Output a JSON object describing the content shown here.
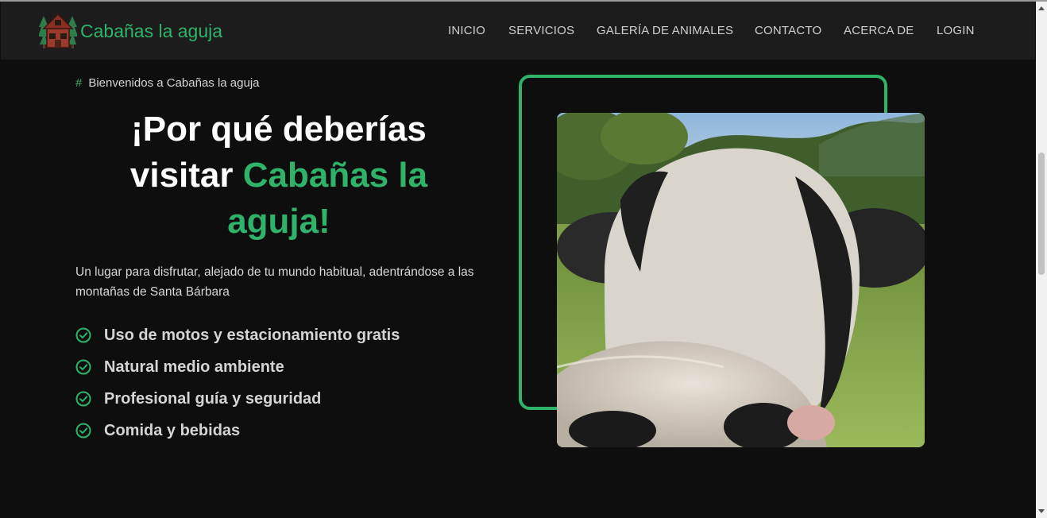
{
  "brand": {
    "name": "Cabañas la aguja",
    "logo_icon": "cabin-with-trees-icon"
  },
  "nav": {
    "items": [
      {
        "label": "INICIO"
      },
      {
        "label": "SERVICIOS"
      },
      {
        "label": "GALERÍA DE ANIMALES"
      },
      {
        "label": "CONTACTO"
      },
      {
        "label": "ACERCA DE"
      },
      {
        "label": "LOGIN"
      }
    ]
  },
  "hero": {
    "kicker_symbol": "#",
    "kicker": "Bienvenidos a Cabañas la aguja",
    "title_part1": "¡Por qué deberías visitar ",
    "title_highlight": "Cabañas la aguja!",
    "description": "Un lugar para disfrutar, alejado de tu mundo habitual, adentrándose a las montañas de Santa Bárbara",
    "features": [
      {
        "label": "Uso de motos y estacionamiento gratis",
        "icon": "check-circle-icon"
      },
      {
        "label": "Natural medio ambiente",
        "icon": "check-circle-icon"
      },
      {
        "label": "Profesional guía y seguridad",
        "icon": "check-circle-icon"
      },
      {
        "label": "Comida y bebidas",
        "icon": "check-circle-icon"
      }
    ],
    "image_subject": "cow-closeup"
  },
  "colors": {
    "accent": "#2fb36a",
    "background": "#0e0e0e",
    "navbar": "#1c1c1c",
    "text": "#d4d4d4"
  }
}
